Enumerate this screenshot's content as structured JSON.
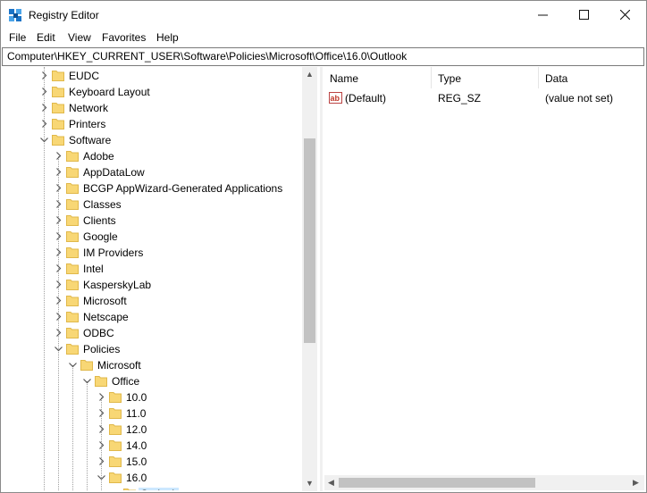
{
  "window": {
    "title": "Registry Editor"
  },
  "titlebar_controls": {
    "minimize": "—",
    "maximize": "☐",
    "close": "✕"
  },
  "menu": [
    "File",
    "Edit",
    "View",
    "Favorites",
    "Help"
  ],
  "address": "Computer\\HKEY_CURRENT_USER\\Software\\Policies\\Microsoft\\Office\\16.0\\Outlook",
  "tree": [
    {
      "label": "EUDC",
      "level": 0,
      "expanded": false
    },
    {
      "label": "Keyboard Layout",
      "level": 0,
      "expanded": false
    },
    {
      "label": "Network",
      "level": 0,
      "expanded": false
    },
    {
      "label": "Printers",
      "level": 0,
      "expanded": false
    },
    {
      "label": "Software",
      "level": 0,
      "expanded": true
    },
    {
      "label": "Adobe",
      "level": 1,
      "expanded": false
    },
    {
      "label": "AppDataLow",
      "level": 1,
      "expanded": false
    },
    {
      "label": "BCGP AppWizard-Generated Applications",
      "level": 1,
      "expanded": false
    },
    {
      "label": "Classes",
      "level": 1,
      "expanded": false
    },
    {
      "label": "Clients",
      "level": 1,
      "expanded": false
    },
    {
      "label": "Google",
      "level": 1,
      "expanded": false
    },
    {
      "label": "IM Providers",
      "level": 1,
      "expanded": false
    },
    {
      "label": "Intel",
      "level": 1,
      "expanded": false
    },
    {
      "label": "KasperskyLab",
      "level": 1,
      "expanded": false
    },
    {
      "label": "Microsoft",
      "level": 1,
      "expanded": false
    },
    {
      "label": "Netscape",
      "level": 1,
      "expanded": false
    },
    {
      "label": "ODBC",
      "level": 1,
      "expanded": false
    },
    {
      "label": "Policies",
      "level": 1,
      "expanded": true
    },
    {
      "label": "Microsoft",
      "level": 2,
      "expanded": true
    },
    {
      "label": "Office",
      "level": 3,
      "expanded": true
    },
    {
      "label": "10.0",
      "level": 4,
      "expanded": false
    },
    {
      "label": "11.0",
      "level": 4,
      "expanded": false
    },
    {
      "label": "12.0",
      "level": 4,
      "expanded": false
    },
    {
      "label": "14.0",
      "level": 4,
      "expanded": false
    },
    {
      "label": "15.0",
      "level": 4,
      "expanded": false
    },
    {
      "label": "16.0",
      "level": 4,
      "expanded": true
    },
    {
      "label": "Outlook",
      "level": 5,
      "expanded": false,
      "selected": true
    }
  ],
  "columns": [
    "Name",
    "Type",
    "Data"
  ],
  "values": [
    {
      "name": "(Default)",
      "type": "REG_SZ",
      "data": "(value not set)",
      "icon": "string-value-icon"
    }
  ],
  "colors": {
    "folder": "#f8d775",
    "folder_dark": "#e0b84a",
    "selection": "#cce8ff",
    "reg_string": "#c0392b"
  }
}
